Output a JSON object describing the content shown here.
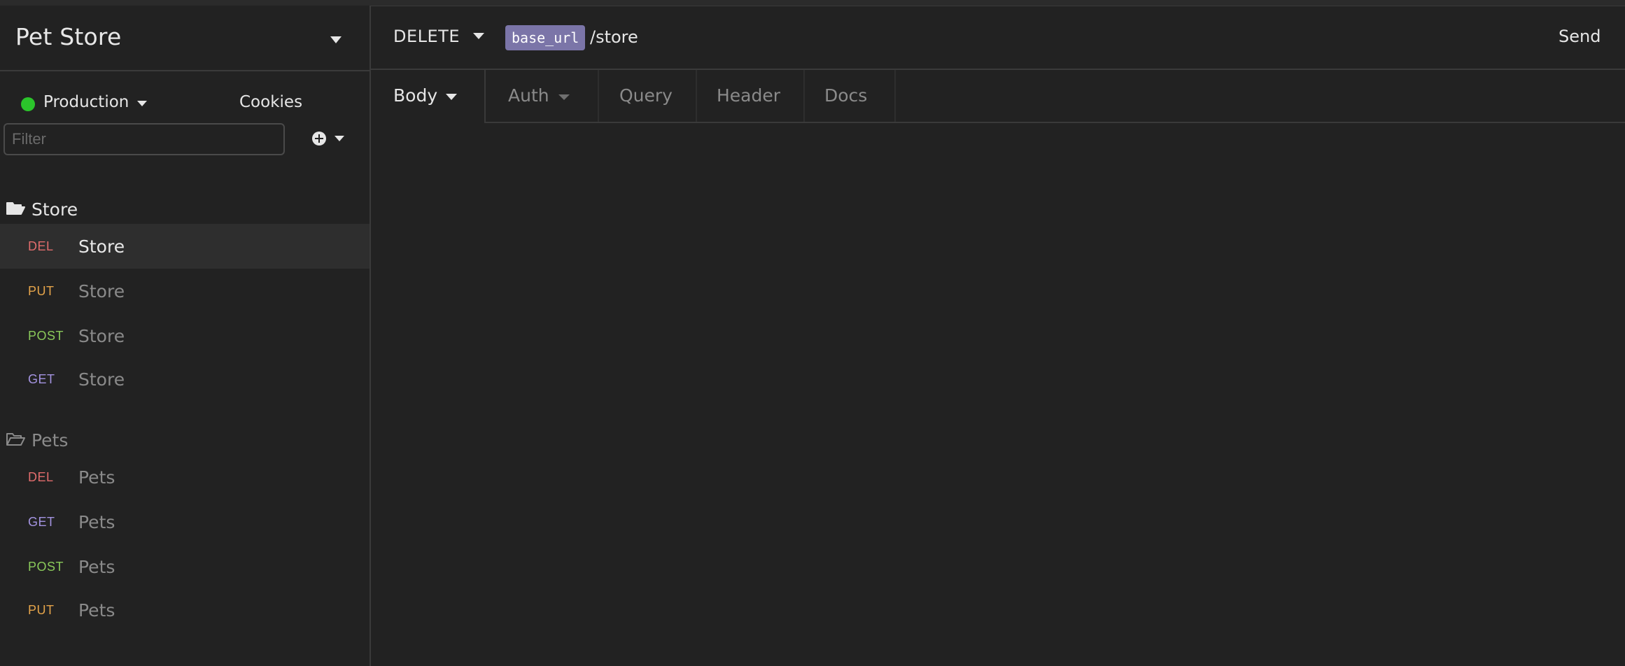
{
  "workspace": {
    "title": "Pet Store"
  },
  "environment": {
    "label": "Production",
    "status_color": "#2bc42b",
    "cookies_label": "Cookies"
  },
  "filter": {
    "placeholder": "Filter",
    "value": ""
  },
  "icons": {
    "add": "plus-circle-icon",
    "folder_open": "folder-open-icon",
    "caret": "caret-down-icon"
  },
  "method_colors": {
    "DEL": "#e06c6c",
    "PUT": "#e5a44a",
    "POST": "#8ac95a",
    "GET": "#a393e0"
  },
  "sidebar": {
    "folders": [
      {
        "label": "Store",
        "expanded": true,
        "requests": [
          {
            "method": "DEL",
            "name": "Store",
            "active": true
          },
          {
            "method": "PUT",
            "name": "Store",
            "active": false
          },
          {
            "method": "POST",
            "name": "Store",
            "active": false
          },
          {
            "method": "GET",
            "name": "Store",
            "active": false
          }
        ]
      },
      {
        "label": "Pets",
        "expanded": true,
        "requests": [
          {
            "method": "DEL",
            "name": "Pets",
            "active": false
          },
          {
            "method": "GET",
            "name": "Pets",
            "active": false
          },
          {
            "method": "POST",
            "name": "Pets",
            "active": false
          },
          {
            "method": "PUT",
            "name": "Pets",
            "active": false
          }
        ]
      }
    ]
  },
  "request": {
    "method": "DELETE",
    "url_variable": "base_url",
    "url_path": "/store",
    "send_label": "Send"
  },
  "tabs": {
    "body": "Body",
    "auth": "Auth",
    "query": "Query",
    "header": "Header",
    "docs": "Docs",
    "active": "body"
  },
  "colors": {
    "background": "#222222",
    "border": "#3a3a3a",
    "url_variable_bg": "#7b75a8"
  }
}
